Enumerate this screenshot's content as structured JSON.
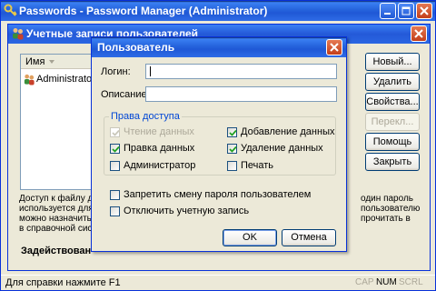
{
  "main_window": {
    "title": "Passwords - Password Manager (Administrator)"
  },
  "accounts_dialog": {
    "title": "Учетные записи пользователей",
    "list": {
      "column_header": "Имя",
      "rows": [
        "Administrator"
      ]
    },
    "buttons": {
      "new": "Новый...",
      "delete": "Удалить",
      "properties": "Свойства...",
      "rename": "Перекл...",
      "help": "Помощь",
      "close": "Закрыть"
    },
    "info_left_lines": [
      "Доступ к файлу да",
      "используется для а",
      "можно назначить п",
      "в справочной систем"
    ],
    "info_right_lines": [
      "один пароль",
      "пользователю",
      "прочитать в"
    ],
    "status_left": "Задействован - "
  },
  "user_dialog": {
    "title": "Пользователь",
    "login_label": "Логин:",
    "login_value": "",
    "description_label": "Описание:",
    "description_value": "",
    "rights_group_label": "Права доступа",
    "rights": {
      "read": {
        "label": "Чтение данных",
        "checked": true,
        "disabled": true
      },
      "add": {
        "label": "Добавление данных",
        "checked": true,
        "disabled": false
      },
      "edit": {
        "label": "Правка данных",
        "checked": true,
        "disabled": false
      },
      "delete": {
        "label": "Удаление данных",
        "checked": true,
        "disabled": false
      },
      "admin": {
        "label": "Администратор",
        "checked": false,
        "disabled": false
      },
      "print": {
        "label": "Печать",
        "checked": false,
        "disabled": false
      }
    },
    "options": {
      "no_password_change": {
        "label": "Запретить смену пароля пользователем",
        "checked": false
      },
      "disable_account": {
        "label": "Отключить учетную запись",
        "checked": false
      }
    },
    "ok_label": "OK",
    "cancel_label": "Отмена"
  },
  "statusbar": {
    "help_text": "Для справки нажмите F1",
    "indicators": [
      {
        "label": "CAP",
        "active": false
      },
      {
        "label": "NUM",
        "active": true
      },
      {
        "label": "SCRL",
        "active": false
      }
    ]
  },
  "icons": {
    "app": "key-ring-icon",
    "user": "users-icon",
    "check": "checkmark-icon"
  },
  "colors": {
    "titlebar": "#2563dc",
    "window_bg": "#ece9d8",
    "close_button": "#c33e1a",
    "group_label": "#0046d5",
    "check_green": "#21a121"
  }
}
